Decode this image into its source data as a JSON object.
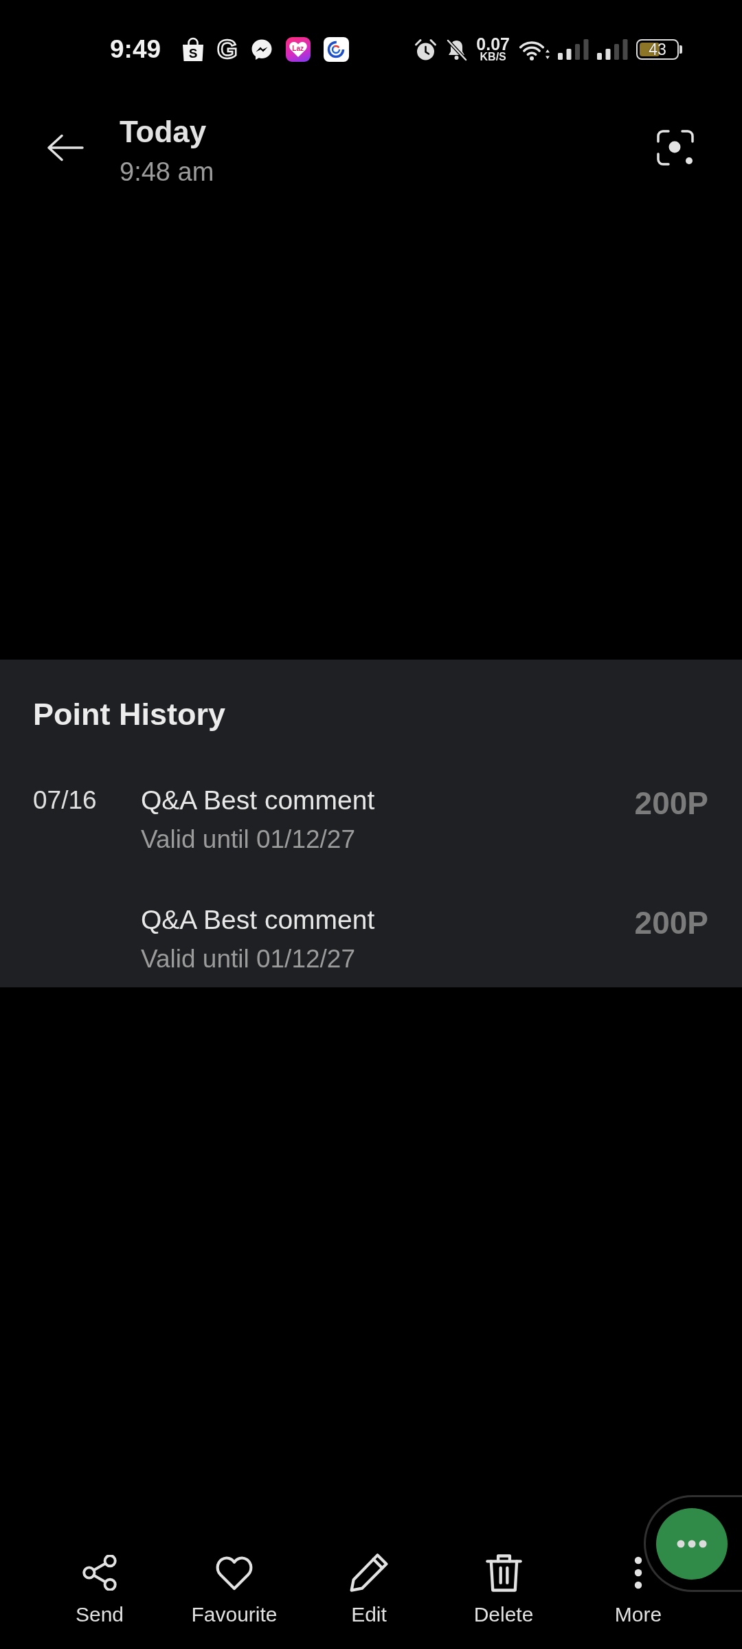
{
  "status_bar": {
    "time": "9:49",
    "app_icons": [
      {
        "kind": "shopping-bag",
        "text": "S"
      },
      {
        "kind": "outlined-letter",
        "text": "G"
      },
      {
        "kind": "chat-bubble"
      },
      {
        "kind": "heart-tile",
        "text": "Laz"
      },
      {
        "kind": "ring-tile"
      }
    ],
    "network_speed": {
      "value": "0.07",
      "unit": "KB/S"
    },
    "battery": "43"
  },
  "header": {
    "title": "Today",
    "subtitle": "9:48 am"
  },
  "point_history": {
    "title": "Point History",
    "entries": [
      {
        "date": "07/16",
        "title": "Q&A Best comment",
        "validity": "Valid until 01/12/27",
        "points": "200P"
      },
      {
        "title": "Q&A Best comment",
        "validity": "Valid until 01/12/27",
        "points": "200P"
      }
    ]
  },
  "bottom_bar": {
    "actions": [
      {
        "kind": "share",
        "label": "Send"
      },
      {
        "kind": "favourite",
        "label": "Favourite"
      },
      {
        "kind": "edit",
        "label": "Edit"
      },
      {
        "kind": "delete",
        "label": "Delete"
      },
      {
        "kind": "more",
        "label": "More"
      }
    ]
  }
}
